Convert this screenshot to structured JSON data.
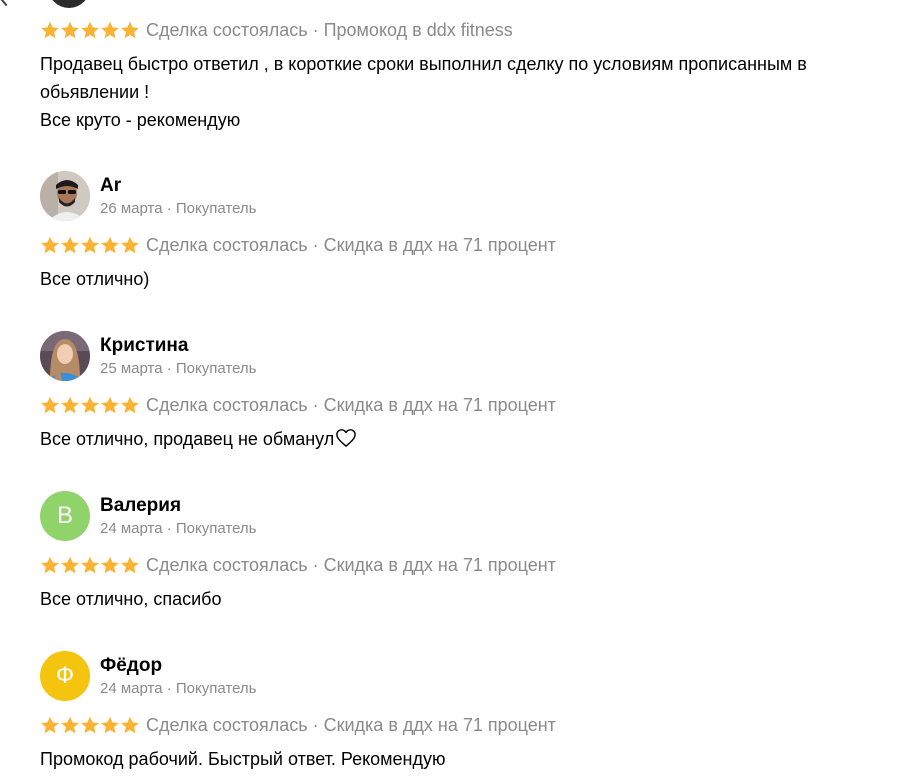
{
  "colors": {
    "star": "#F8B332",
    "meta_text": "#8A8A8A",
    "avatar_valeria": "#8FD36A",
    "avatar_fedor": "#F4C40E"
  },
  "icons": {
    "star": "star-icon",
    "heart": "heart-icon"
  },
  "reviews": [
    {
      "rating": 5,
      "deal": "Сделка состоялась · Промокод в ddx fitness",
      "text_lines": [
        "Продавец быстро ответил , в короткие сроки выполнил сделку по условиям прописанным в",
        "обьявлении !",
        "Все круто - рекомендую"
      ]
    },
    {
      "name": "Ar",
      "meta": "26 марта · Покупатель",
      "rating": 5,
      "deal": "Сделка состоялась · Скидка в ддх на 71 процент",
      "text": "Все отлично)"
    },
    {
      "name": "Кристина",
      "meta": "25 марта · Покупатель",
      "rating": 5,
      "deal": "Сделка состоялась · Скидка в ддх на 71 процент",
      "text": "Все отлично, продавец не обманул"
    },
    {
      "name": "Валерия",
      "avatar_letter": "В",
      "meta": "24 марта · Покупатель",
      "rating": 5,
      "deal": "Сделка состоялась · Скидка в ддх на 71 процент",
      "text": "Все отлично, спасибо"
    },
    {
      "name": "Фёдор",
      "avatar_letter": "Ф",
      "meta": "24 марта · Покупатель",
      "rating": 5,
      "deal": "Сделка состоялась · Скидка в ддх на 71 процент",
      "text": "Промокод рабочий. Быстрый ответ. Рекомендую"
    }
  ]
}
